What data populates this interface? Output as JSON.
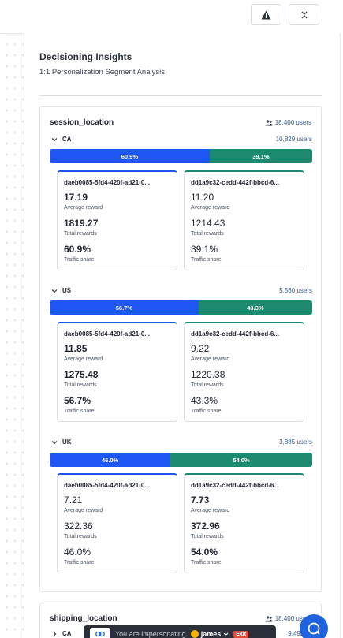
{
  "header": {
    "title": "Decisioning Insights",
    "subtitle": "1:1 Personalization Segment Analysis"
  },
  "features": [
    {
      "name": "session_location",
      "users": "18,400 users",
      "segments": [
        {
          "label": "CA",
          "users": "10,829 users",
          "split": [
            60.9,
            39.1
          ],
          "split_labels": [
            "60.9%",
            "39.1%"
          ],
          "variants": [
            {
              "id": "daeb0085-5fd4-420f-ad21-0...",
              "avg": "17.19",
              "total": "1819.27",
              "share": "60.9%"
            },
            {
              "id": "dd1a9c32-cedd-442f-bbcd-6...",
              "avg": "11.20",
              "total": "1214.43",
              "share": "39.1%"
            }
          ]
        },
        {
          "label": "US",
          "users": "5,560 users",
          "split": [
            56.7,
            43.3
          ],
          "split_labels": [
            "56.7%",
            "43.3%"
          ],
          "variants": [
            {
              "id": "daeb0085-5fd4-420f-ad21-0...",
              "avg": "11.85",
              "total": "1275.48",
              "share": "56.7%"
            },
            {
              "id": "dd1a9c32-cedd-442f-bbcd-6...",
              "avg": "9.22",
              "total": "1220.38",
              "share": "43.3%"
            }
          ]
        },
        {
          "label": "UK",
          "users": "3,885 users",
          "split": [
            46.0,
            54.0
          ],
          "split_labels": [
            "46.0%",
            "54.0%"
          ],
          "variants": [
            {
              "id": "daeb0085-5fd4-420f-ad21-0...",
              "avg": "7.21",
              "total": "322.36",
              "share": "46.0%"
            },
            {
              "id": "dd1a9c32-cedd-442f-bbcd-6...",
              "avg": "7.73",
              "total": "372.96",
              "share": "54.0%"
            }
          ]
        }
      ]
    },
    {
      "name": "shipping_location",
      "users": "18,400 users",
      "segments": [
        {
          "label": "CA",
          "users": "9,492 us"
        }
      ]
    }
  ],
  "captions": {
    "avg": "Average reward",
    "total": "Total rewards",
    "share": "Traffic share"
  },
  "impersonation": {
    "text": "You are impersonating",
    "user": "james",
    "exit": "Exit"
  },
  "colors": {
    "variant_a": "#1f57f5",
    "variant_b": "#1b8a6e"
  },
  "icons": {
    "warning": "warning-icon",
    "collapse": "collapse-icon",
    "users": "users-icon",
    "chevron": "chevron-down-icon",
    "link": "link-icon",
    "chat": "chat-icon"
  }
}
